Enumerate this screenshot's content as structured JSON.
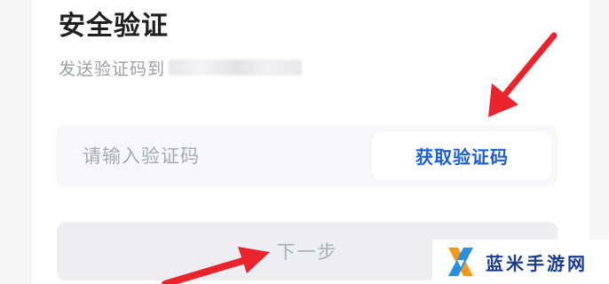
{
  "page": {
    "title": "安全验证",
    "subtitle": "发送验证码到",
    "masked_phone_icon": "masked-phone-number"
  },
  "code_field": {
    "placeholder": "请输入验证码",
    "get_code_label": "获取验证码"
  },
  "next_button": {
    "label": "下一步"
  },
  "annotations": {
    "arrow_color": "#e8242c"
  },
  "watermark": {
    "text": "蓝米手游网"
  },
  "colors": {
    "accent": "#1e5fcc",
    "field_bg": "#f6f7fa",
    "disabled_button_bg": "#eceef2",
    "disabled_text": "#a9afb8",
    "watermark_brand": "#1a3c8c"
  }
}
